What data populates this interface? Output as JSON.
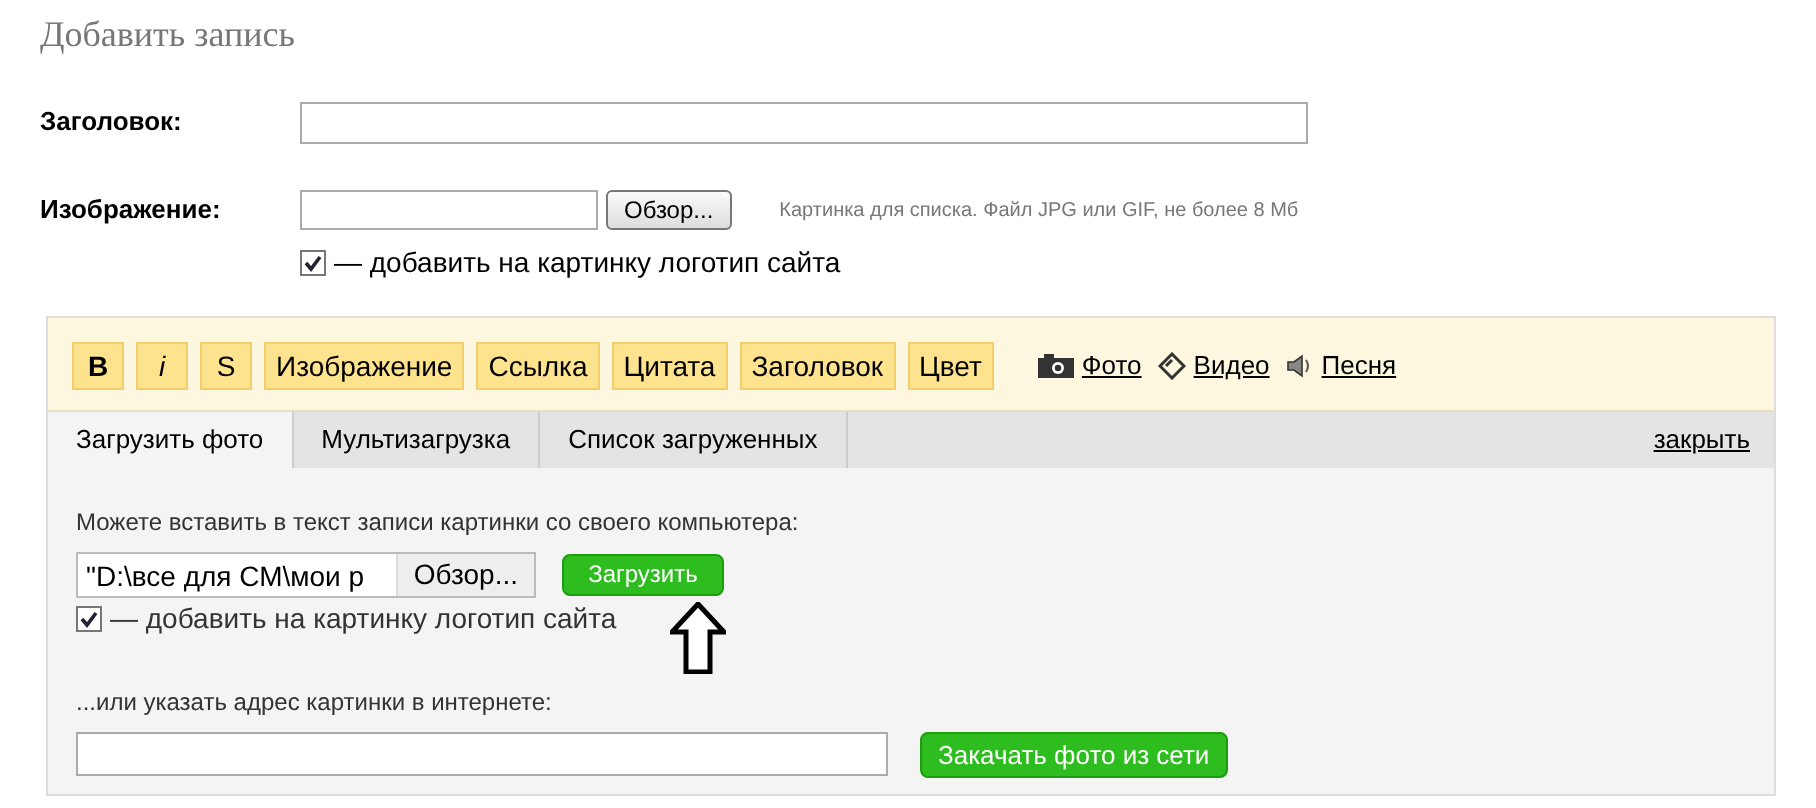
{
  "page_title": "Добавить запись",
  "title_field": {
    "label": "Заголовок:"
  },
  "image_field": {
    "label": "Изображение:",
    "browse": "Обзор...",
    "hint": "Картинка для списка. Файл JPG или GIF, не более 8 Мб"
  },
  "logo_checkbox": {
    "label": "— добавить на картинку логотип сайта",
    "checked": true
  },
  "toolbar": [
    {
      "label": "B",
      "kind": "bold"
    },
    {
      "label": "i",
      "kind": "italic"
    },
    {
      "label": "S",
      "kind": "plain"
    },
    {
      "label": "Изображение",
      "kind": "plain"
    },
    {
      "label": "Ссылка",
      "kind": "plain"
    },
    {
      "label": "Цитата",
      "kind": "plain"
    },
    {
      "label": "Заголовок",
      "kind": "plain"
    },
    {
      "label": "Цвет",
      "kind": "plain"
    }
  ],
  "media_links": [
    {
      "label": "Фото",
      "kind": "camera"
    },
    {
      "label": "Видео",
      "kind": "video"
    },
    {
      "label": "Песня",
      "kind": "speaker"
    }
  ],
  "tabs": [
    {
      "label": "Загрузить фото",
      "selected": true
    },
    {
      "label": "Мультизагрузка",
      "selected": false
    },
    {
      "label": "Список загруженных",
      "selected": false
    }
  ],
  "close_link": "закрыть",
  "upload": {
    "intro": "Можете вставить в текст записи картинки со своего компьютера:",
    "file_value": "\"D:\\все для СМ\\мои р",
    "browse": "Обзор...",
    "upload_button": "Загрузить",
    "logo_checkbox": {
      "label": "— добавить на картинку логотип сайта",
      "checked": true
    },
    "url_intro": "...или указать адрес картинки в интернете:",
    "url_button": "Закачать фото из сети"
  }
}
